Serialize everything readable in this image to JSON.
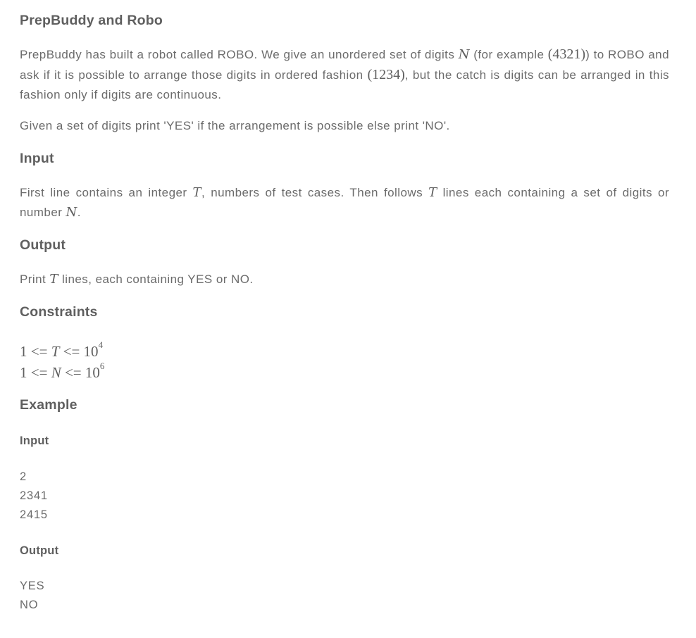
{
  "problem": {
    "title": "PrepBuddy and Robo",
    "statement": {
      "p1_a": "PrepBuddy has built a robot called ROBO. We give an unordered set of digits ",
      "p1_var_n": "N",
      "p1_b": " (for example ",
      "p1_ex1": "(4321)",
      "p1_c": ") to ROBO and ask if it is possible to arrange those digits in ordered fashion ",
      "p1_ex2": "(1234)",
      "p1_d": ", but the catch is digits can be arranged in this fashion only if digits are continuous.",
      "p2": "Given a set of digits print 'YES' if the arrangement is possible else print 'NO'."
    },
    "input_section": {
      "heading": "Input",
      "t1": "First line contains an integer ",
      "var_t": "T",
      "t2": ", numbers of test cases. Then follows ",
      "t3": " lines each containing a set of digits or number ",
      "var_n": "N",
      "t4": "."
    },
    "output_section": {
      "heading": "Output",
      "t1": "Print ",
      "var_t": "T",
      "t2": " lines, each containing YES or NO."
    },
    "constraints": {
      "heading": "Constraints",
      "c1_lhs": "1 <= ",
      "c1_var": "T",
      "c1_rhs": " <= 10",
      "c1_exp": "4",
      "c2_lhs": "1 <= ",
      "c2_var": "N",
      "c2_rhs": " <= 10",
      "c2_exp": "6"
    },
    "example": {
      "heading": "Example",
      "input_heading": "Input",
      "input_lines": [
        "2",
        "2341",
        "2415"
      ],
      "output_heading": "Output",
      "output_lines": [
        "YES",
        "NO"
      ]
    }
  }
}
